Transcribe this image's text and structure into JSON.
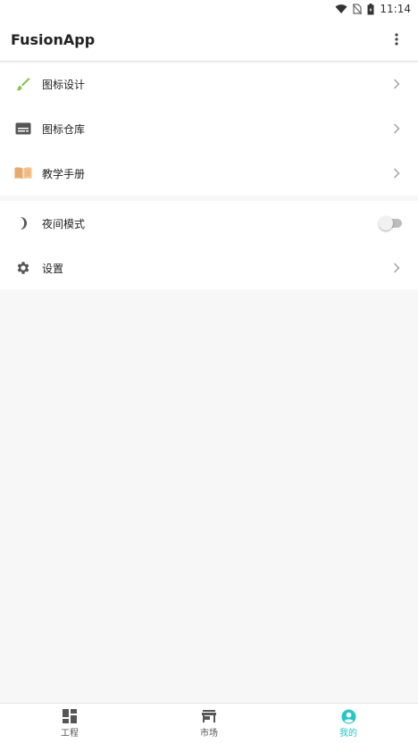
{
  "status_bar": {
    "time": "11:14"
  },
  "app_bar": {
    "title": "FusionApp"
  },
  "menu_section_1": [
    {
      "label": "图标设计",
      "icon": "brush-icon"
    },
    {
      "label": "图标仓库",
      "icon": "keyboard-icon"
    },
    {
      "label": "教学手册",
      "icon": "book-icon"
    }
  ],
  "menu_section_2": {
    "night_mode": {
      "label": "夜间模式",
      "icon": "moon-icon",
      "enabled": false
    },
    "settings": {
      "label": "设置",
      "icon": "gear-icon"
    }
  },
  "bottom_nav": [
    {
      "label": "工程",
      "icon": "dashboard-icon",
      "active": false
    },
    {
      "label": "市场",
      "icon": "store-icon",
      "active": false
    },
    {
      "label": "我的",
      "icon": "account-circle-icon",
      "active": true
    }
  ],
  "colors": {
    "accent": "#26c6c6",
    "brush": "#8bc34a",
    "book": "#e8a96b"
  }
}
